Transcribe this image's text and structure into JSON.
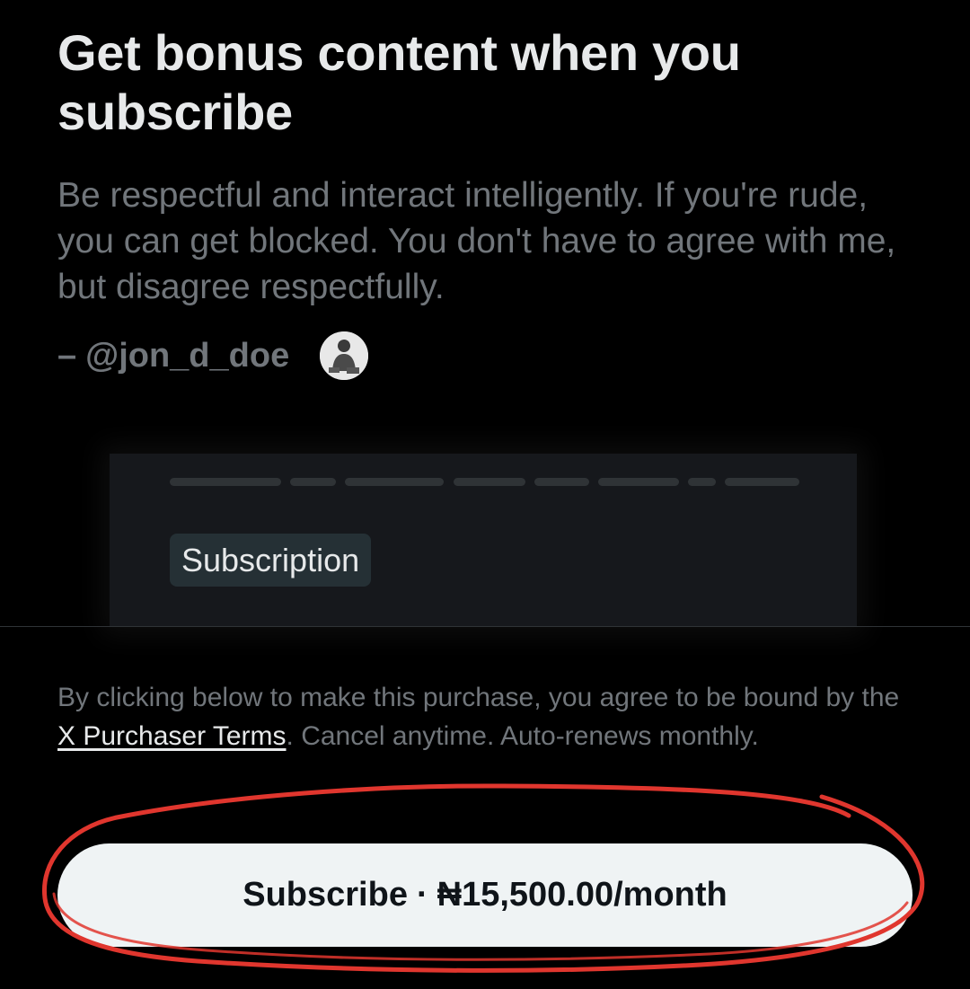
{
  "header": {
    "title": "Get bonus content when you subscribe",
    "description": "Be respectful and interact intelligently. If you're rude, you can get blocked. You don't have to agree with me, but disagree respectfully.",
    "author_dash": "–",
    "author_handle": "@jon_d_doe"
  },
  "preview": {
    "chip_label": "Subscription"
  },
  "footer": {
    "legal_prefix": "By clicking below to make this purchase, you agree to be bound by the ",
    "legal_link": "X Purchaser Terms",
    "legal_suffix": ". Cancel anytime. Auto-renews monthly.",
    "button_action": "Subscribe",
    "button_separator": "·",
    "button_price": "₦15,500.00/month"
  },
  "colors": {
    "background": "#000000",
    "primary_text": "#e7e9ea",
    "secondary_text": "#71767b",
    "button_bg": "#eff3f4",
    "button_text": "#0f1419",
    "annotation": "#e0362e"
  }
}
